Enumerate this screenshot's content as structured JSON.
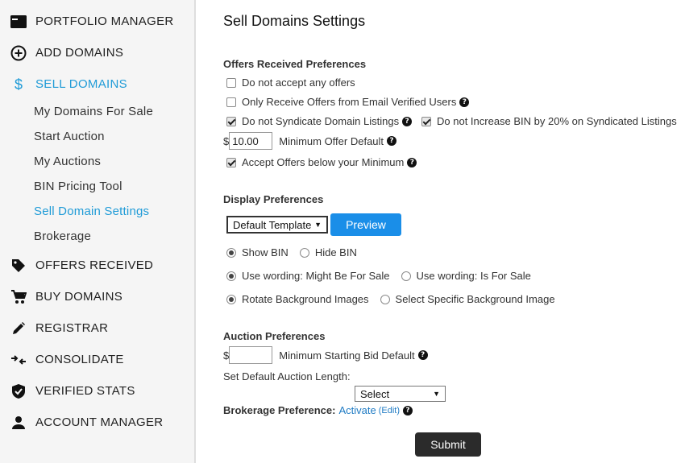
{
  "sidebar": {
    "items": [
      {
        "label": "PORTFOLIO MANAGER",
        "icon": "portfolio-icon"
      },
      {
        "label": "ADD DOMAINS",
        "icon": "plus-circle-icon"
      },
      {
        "label": "SELL DOMAINS",
        "icon": "dollar-icon"
      },
      {
        "label": "OFFERS RECEIVED",
        "icon": "tag-icon"
      },
      {
        "label": "BUY DOMAINS",
        "icon": "cart-icon"
      },
      {
        "label": "REGISTRAR",
        "icon": "pencil-icon"
      },
      {
        "label": "CONSOLIDATE",
        "icon": "consolidate-arrows-icon"
      },
      {
        "label": "VERIFIED STATS",
        "icon": "shield-check-icon"
      },
      {
        "label": "ACCOUNT MANAGER",
        "icon": "person-icon"
      }
    ],
    "sub_items": [
      "My Domains For Sale",
      "Start Auction",
      "My Auctions",
      "BIN Pricing Tool",
      "Sell Domain Settings",
      "Brokerage"
    ],
    "active_item": "SELL DOMAINS",
    "active_sub_item": "Sell Domain Settings"
  },
  "main": {
    "title": "Sell Domains Settings",
    "offers": {
      "title": "Offers Received Preferences",
      "do_not_accept": "Do not accept any offers",
      "verified_only": "Only Receive Offers from Email Verified Users",
      "no_syndicate": "Do not Syndicate Domain Listings",
      "no_increase_bin": "Do not Increase BIN by 20% on Syndicated Listings",
      "currency": "$",
      "min_offer_value": "10.00",
      "min_offer_label": "Minimum Offer Default",
      "accept_below_min": "Accept Offers below your Minimum"
    },
    "display": {
      "title": "Display Preferences",
      "template_selected": "Default Template",
      "preview_label": "Preview",
      "show_bin": "Show BIN",
      "hide_bin": "Hide BIN",
      "wording_might": "Use wording: Might Be For Sale",
      "wording_is": "Use wording: Is For Sale",
      "rotate_bg": "Rotate Background Images",
      "specific_bg": "Select Specific Background Image"
    },
    "auction": {
      "title": "Auction Preferences",
      "currency": "$",
      "min_bid_value": "",
      "min_bid_label": "Minimum Starting Bid Default",
      "length_label": "Set Default Auction Length:",
      "length_selected": "Select"
    },
    "brokerage": {
      "label": "Brokerage Preference:",
      "activate": "Activate",
      "edit": "(Edit)"
    },
    "help_glyph": "?",
    "dropdown_arrow": "▼",
    "submit_label": "Submit"
  },
  "colors": {
    "accent": "#1f9bd7",
    "preview_button": "#1a8ee8",
    "submit_button": "#2b2b2b",
    "sidebar_bg": "#f5f5f5"
  }
}
